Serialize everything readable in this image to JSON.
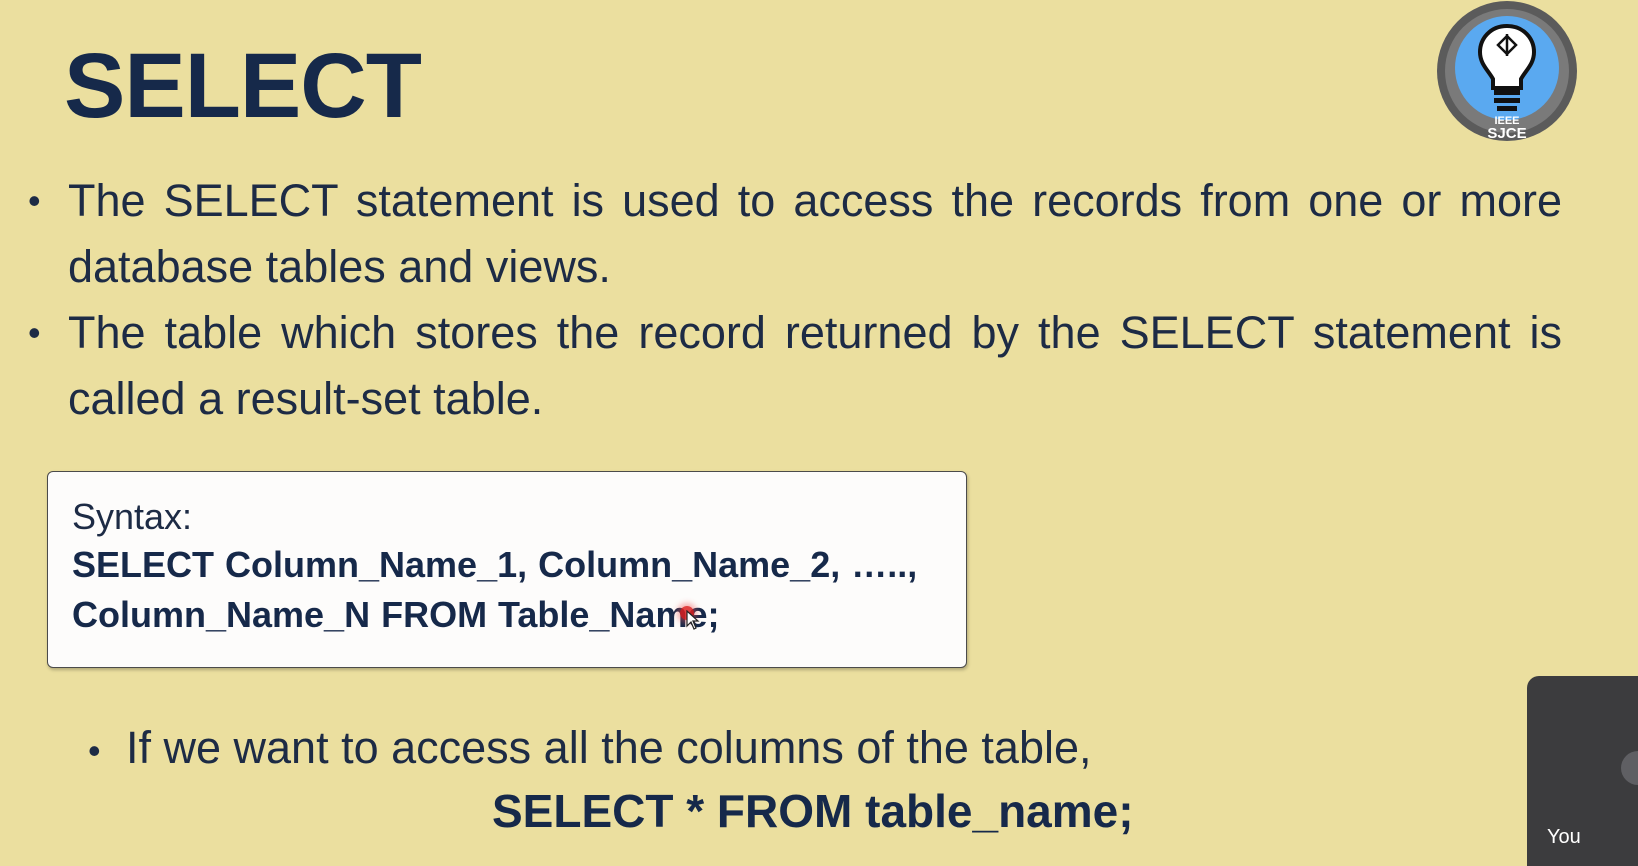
{
  "slide": {
    "title": "SELECT",
    "bullets": [
      "The SELECT statement is used to access the records from one or more database tables and views.",
      "The table which stores the record returned by the SELECT statement is called a result-set table."
    ],
    "syntax_label": "Syntax:",
    "syntax_line_1": "SELECT Column_Name_1, Column_Name_2, …..,",
    "syntax_line_2": "Column_Name_N FROM Table_Name;",
    "bullet_2": "If we want to access all the columns of the table,",
    "example_code": "SELECT * FROM table_name;"
  },
  "logo": {
    "text_top": "IEEE",
    "text_bottom": "SJCE",
    "icon": "lightbulb-icon"
  },
  "video_tile": {
    "name": "You"
  },
  "colors": {
    "background": "#ebdf9f",
    "title": "#16294a",
    "text": "#1d2b45",
    "logo_blue": "#5aa9f0",
    "logo_ring": "#5b5b5b"
  }
}
